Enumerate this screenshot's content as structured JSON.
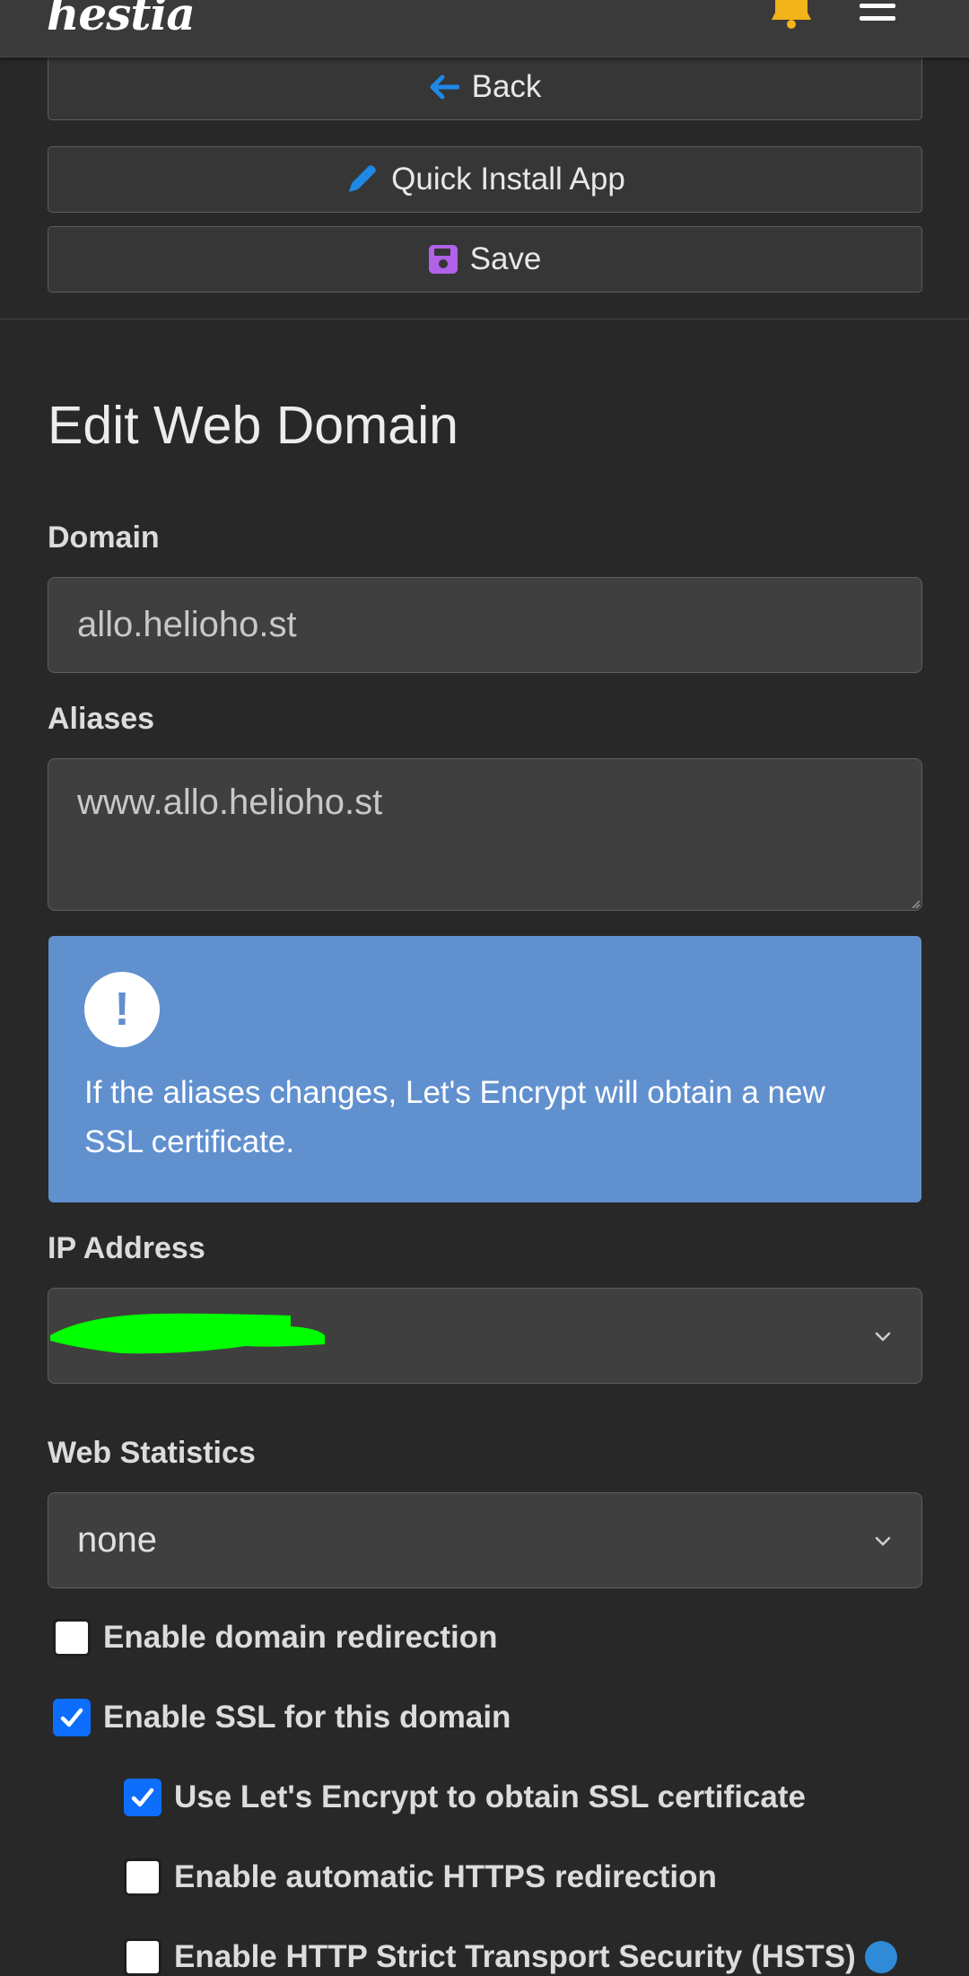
{
  "app": {
    "logo_text": "hestia",
    "icons": {
      "notifications": "bell-icon",
      "menu": "hamburger-menu-icon"
    },
    "colors": {
      "bell": "#f3b31a",
      "back_arrow": "#1e88e5",
      "pencil": "#1e88e5",
      "save_icon": "#b062e8",
      "checkbox_on": "#0d6efd",
      "alert_bg": "#6190cf"
    }
  },
  "toolbar": {
    "back_label": "Back",
    "quick_install_label": "Quick Install App",
    "save_label": "Save"
  },
  "page": {
    "title": "Edit Web Domain"
  },
  "form": {
    "domain_label": "Domain",
    "domain_value": "allo.helioho.st",
    "aliases_label": "Aliases",
    "aliases_value": "www.allo.helioho.st",
    "alert_text": "If the aliases changes, Let's Encrypt will obtain a new SSL certificate.",
    "ip_label": "IP Address",
    "stats_label": "Web Statistics",
    "stats_value": "none",
    "redirect_label": "Enable domain redirection",
    "redirect_checked": false,
    "ssl_label": "Enable SSL for this domain",
    "ssl_checked": true,
    "letsencrypt_label": "Use Let's Encrypt to obtain SSL certificate",
    "letsencrypt_checked": true,
    "https_redirect_label": "Enable automatic HTTPS redirection",
    "https_redirect_checked": false,
    "hsts_label": "Enable HTTP Strict Transport Security (HSTS)",
    "hsts_checked": false
  }
}
